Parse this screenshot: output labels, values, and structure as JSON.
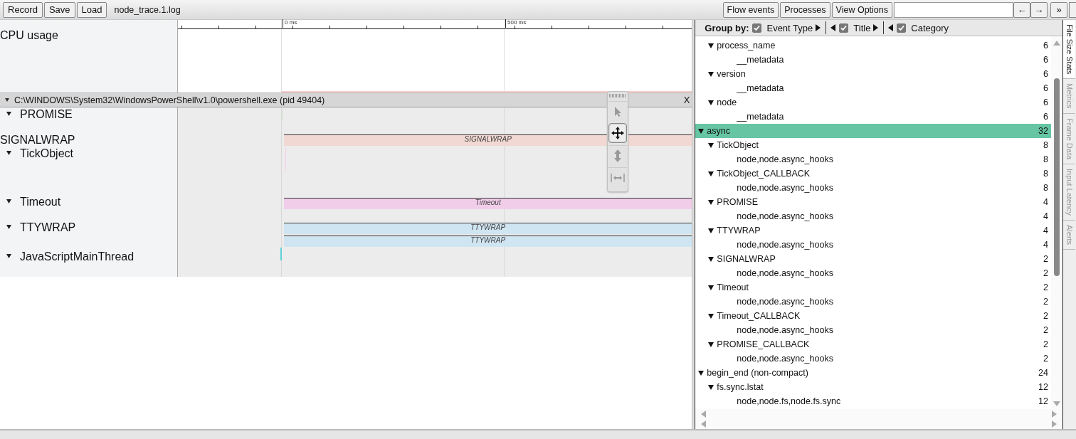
{
  "toolbar": {
    "left_buttons": [
      "Record",
      "Save",
      "Load"
    ],
    "filename": "node_trace.1.log",
    "right_buttons": [
      "Flow events",
      "Processes",
      "View Options"
    ],
    "nav_buttons": [
      "←",
      "→"
    ],
    "more_button": "»"
  },
  "timeline": {
    "ruler": [
      "0 ms",
      "500 ms"
    ],
    "cpu_label": "CPU usage",
    "process": {
      "title": "C:\\WINDOWS\\System32\\WindowsPowerShell\\v1.0\\powershell.exe (pid 49404)",
      "expanded": true,
      "close": "X"
    },
    "tracks": [
      {
        "name": "PROMISE",
        "kind": "group",
        "expanded": true
      },
      {
        "name": "SIGNALWRAP",
        "kind": "row",
        "slices": [
          {
            "label": "SIGNALWRAP",
            "color": "#f2d8d2"
          }
        ]
      },
      {
        "name": "TickObject",
        "kind": "group",
        "expanded": true
      },
      {
        "name": "Timeout",
        "kind": "group",
        "expanded": true,
        "slices": [
          {
            "label": "Timeout",
            "color": "#f2cdea"
          }
        ]
      },
      {
        "name": "TTYWRAP",
        "kind": "group",
        "expanded": true,
        "slices": [
          {
            "label": "TTYWRAP",
            "color": "#d0e5f2"
          },
          {
            "label": "TTYWRAP",
            "color": "#d0e5f2"
          }
        ]
      },
      {
        "name": "JavaScriptMainThread",
        "kind": "group",
        "expanded": true
      }
    ],
    "tools": [
      {
        "kind": "select",
        "selected": false
      },
      {
        "kind": "pan",
        "selected": true
      },
      {
        "kind": "zoom",
        "selected": false
      },
      {
        "kind": "timing",
        "selected": false
      }
    ]
  },
  "panel": {
    "group_by_label": "Group by:",
    "group_by": [
      {
        "label": "Event Type",
        "checked": true
      },
      {
        "label": "Title",
        "checked": true
      },
      {
        "label": "Category",
        "checked": true
      }
    ],
    "tree": [
      {
        "children": [
          {
            "label": "process_name",
            "count": "6",
            "expanded": true,
            "selected": false,
            "children": [
              {
                "label": "__metadata",
                "count": "6",
                "selected": false
              }
            ]
          },
          {
            "label": "version",
            "count": "6",
            "expanded": true,
            "selected": false,
            "children": [
              {
                "label": "__metadata",
                "count": "6",
                "selected": false
              }
            ]
          },
          {
            "label": "node",
            "count": "6",
            "expanded": true,
            "selected": false,
            "children": [
              {
                "label": "__metadata",
                "count": "6",
                "selected": false
              }
            ]
          }
        ]
      },
      {
        "label": "async",
        "count": "32",
        "expanded": true,
        "selected": true,
        "children": [
          {
            "label": "TickObject",
            "count": "8",
            "expanded": true,
            "selected": false,
            "children": [
              {
                "label": "node,node.async_hooks",
                "count": "8",
                "selected": false
              }
            ]
          },
          {
            "label": "TickObject_CALLBACK",
            "count": "8",
            "expanded": true,
            "selected": false,
            "children": [
              {
                "label": "node,node.async_hooks",
                "count": "8",
                "selected": false
              }
            ]
          },
          {
            "label": "PROMISE",
            "count": "4",
            "expanded": true,
            "selected": false,
            "children": [
              {
                "label": "node,node.async_hooks",
                "count": "4",
                "selected": false
              }
            ]
          },
          {
            "label": "TTYWRAP",
            "count": "4",
            "expanded": true,
            "selected": false,
            "children": [
              {
                "label": "node,node.async_hooks",
                "count": "4",
                "selected": false
              }
            ]
          },
          {
            "label": "SIGNALWRAP",
            "count": "2",
            "expanded": true,
            "selected": false,
            "children": [
              {
                "label": "node,node.async_hooks",
                "count": "2",
                "selected": false
              }
            ]
          },
          {
            "label": "Timeout",
            "count": "2",
            "expanded": true,
            "selected": false,
            "children": [
              {
                "label": "node,node.async_hooks",
                "count": "2",
                "selected": false
              }
            ]
          },
          {
            "label": "Timeout_CALLBACK",
            "count": "2",
            "expanded": true,
            "selected": false,
            "children": [
              {
                "label": "node,node.async_hooks",
                "count": "2",
                "selected": false
              }
            ]
          },
          {
            "label": "PROMISE_CALLBACK",
            "count": "2",
            "expanded": true,
            "selected": false,
            "children": [
              {
                "label": "node,node.async_hooks",
                "count": "2",
                "selected": false
              }
            ]
          }
        ]
      },
      {
        "label": "begin_end (non-compact)",
        "count": "24",
        "expanded": true,
        "selected": false,
        "children": [
          {
            "label": "fs.sync.lstat",
            "count": "12",
            "expanded": true,
            "selected": false,
            "children": [
              {
                "label": "node,node.fs,node.fs.sync",
                "count": "12",
                "selected": false
              }
            ]
          }
        ]
      }
    ],
    "side_tabs": [
      {
        "label": "File Size Stats",
        "selected": true
      },
      {
        "label": "Metrics",
        "selected": false
      },
      {
        "label": "Frame Data",
        "selected": false
      },
      {
        "label": "Input Latency",
        "selected": false
      },
      {
        "label": "Alerts",
        "selected": false
      }
    ]
  }
}
